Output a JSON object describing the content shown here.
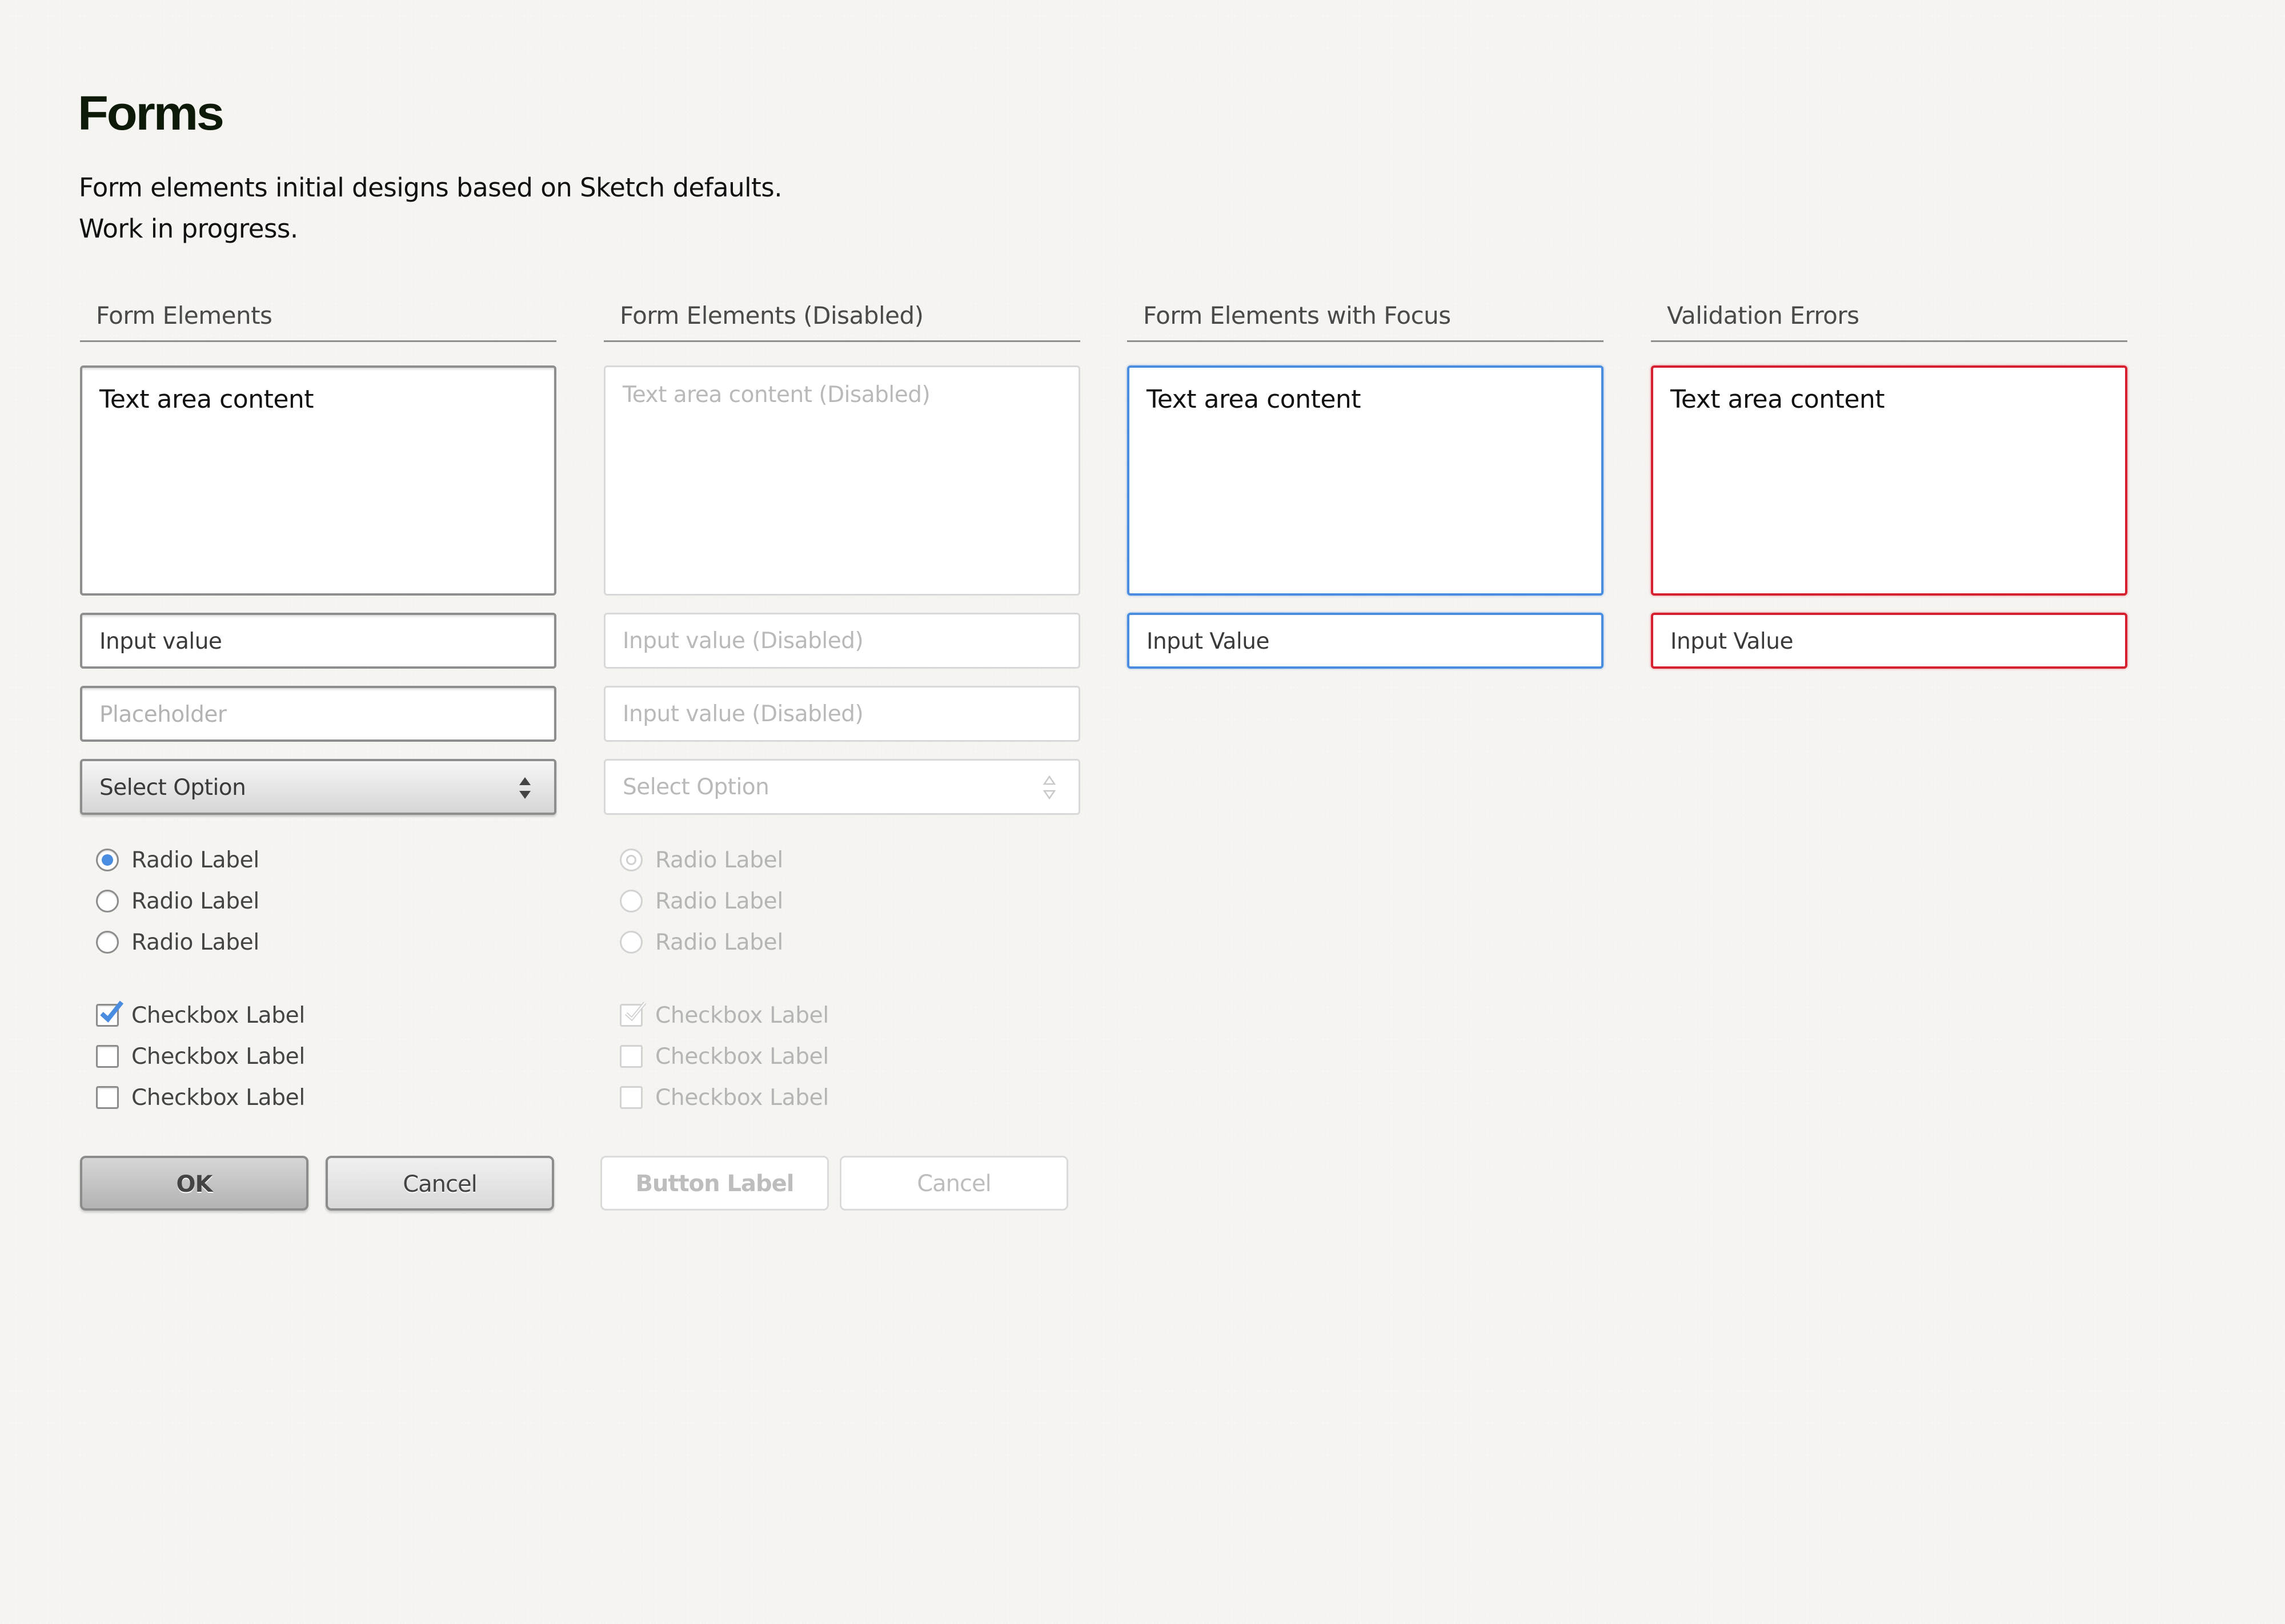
{
  "header": {
    "title": "Forms",
    "intro_line1": "Form elements initial designs based on Sketch defaults.",
    "intro_line2": "Work in progress."
  },
  "colors": {
    "focus": "#4a8de0",
    "error": "#d7202f",
    "accent": "#4a8de0",
    "title": "#0e1a08"
  },
  "columns": {
    "normal": {
      "heading": "Form Elements",
      "textarea_value": "Text area content",
      "input_value": "Input value",
      "input_placeholder": "Placeholder",
      "select_value": "Select Option",
      "radios": [
        {
          "label": "Radio Label",
          "checked": true
        },
        {
          "label": "Radio Label",
          "checked": false
        },
        {
          "label": "Radio Label",
          "checked": false
        }
      ],
      "checkboxes": [
        {
          "label": "Checkbox Label",
          "checked": true
        },
        {
          "label": "Checkbox Label",
          "checked": false
        },
        {
          "label": "Checkbox Label",
          "checked": false
        }
      ],
      "primary_button": "OK",
      "secondary_button": "Cancel"
    },
    "disabled": {
      "heading": "Form Elements (Disabled)",
      "textarea_value": "Text area content (Disabled)",
      "input_value_1": "Input value (Disabled)",
      "input_value_2": "Input value (Disabled)",
      "select_value": "Select Option",
      "radios": [
        {
          "label": "Radio Label",
          "checked": true
        },
        {
          "label": "Radio Label",
          "checked": false
        },
        {
          "label": "Radio Label",
          "checked": false
        }
      ],
      "checkboxes": [
        {
          "label": "Checkbox Label",
          "checked": true
        },
        {
          "label": "Checkbox Label",
          "checked": false
        },
        {
          "label": "Checkbox Label",
          "checked": false
        }
      ],
      "primary_button": "Button Label",
      "secondary_button": "Cancel"
    },
    "focus": {
      "heading": "Form Elements with Focus",
      "textarea_value": "Text area content",
      "input_value": "Input Value"
    },
    "errors": {
      "heading": "Validation Errors",
      "textarea_value": "Text area content",
      "input_value": "Input Value"
    }
  }
}
